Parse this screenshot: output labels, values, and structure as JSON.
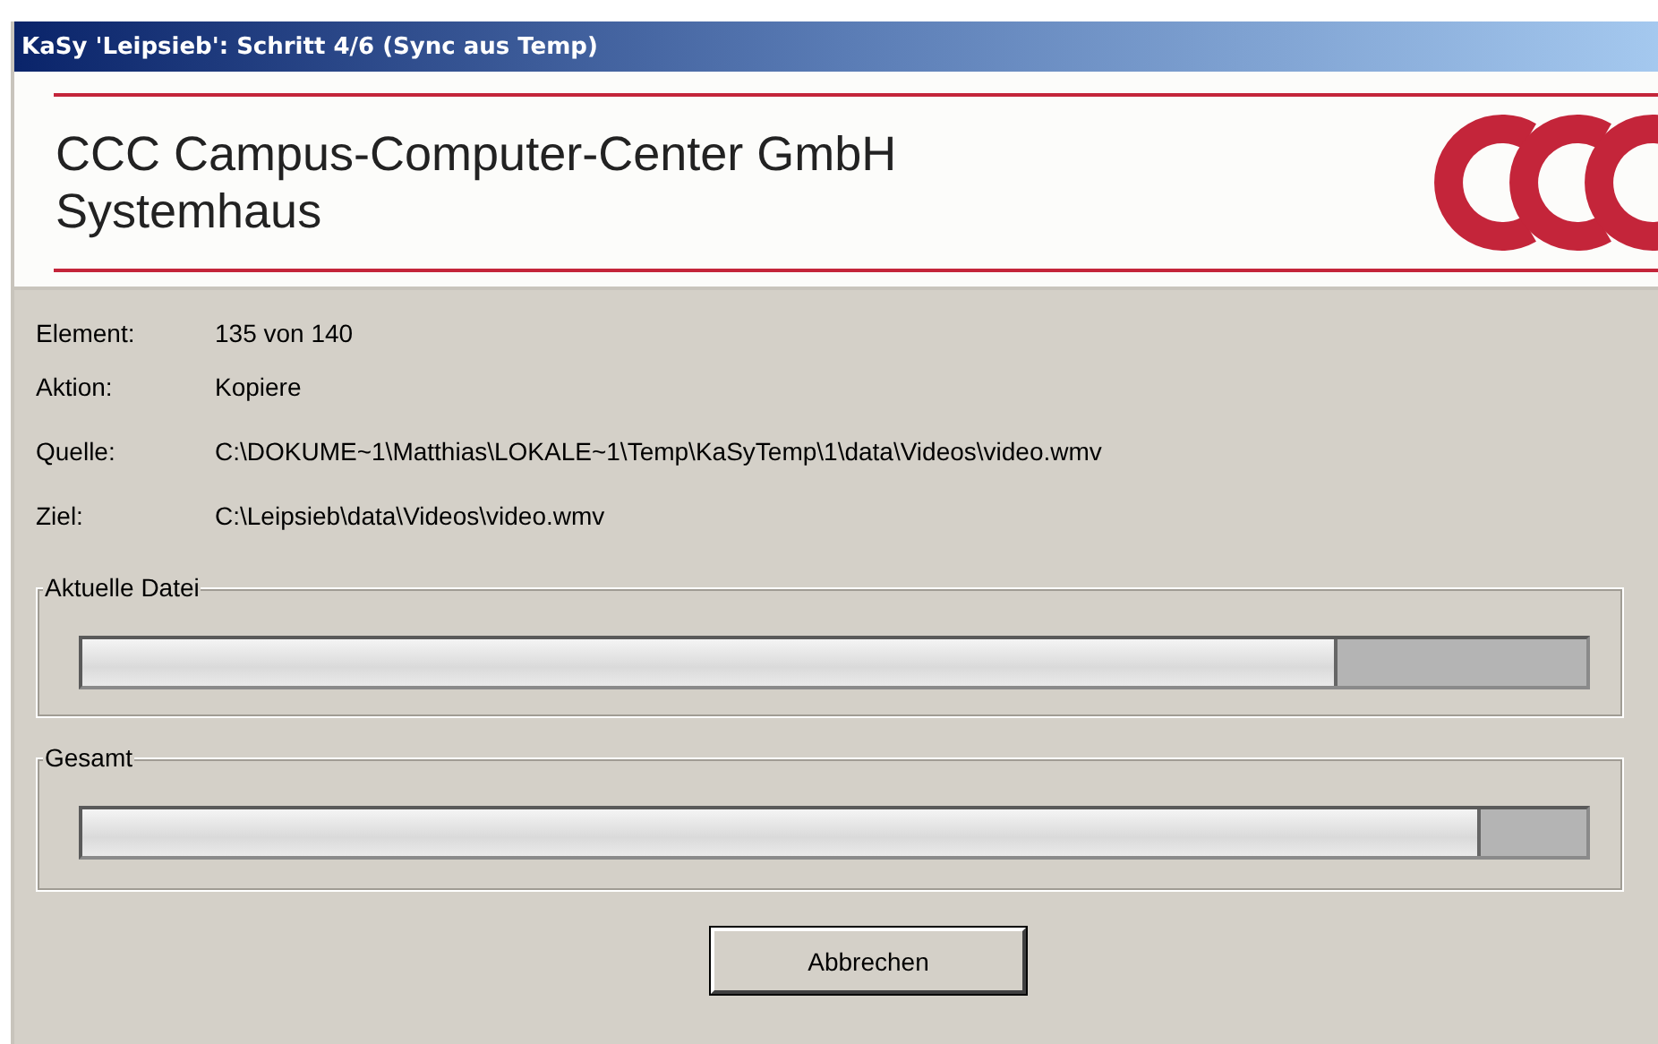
{
  "window": {
    "title": "KaSy 'Leipsieb': Schritt 4/6 (Sync aus Temp)"
  },
  "header": {
    "company": "CCC Campus-Computer-Center GmbH",
    "subtitle": "Systemhaus"
  },
  "details": [
    {
      "label": "Element:",
      "value": "135 von 140"
    },
    {
      "label": "Aktion:",
      "value": "Kopiere"
    },
    {
      "label": "Quelle:",
      "value": "C:\\DOKUME~1\\Matthias\\LOKALE~1\\Temp\\KaSyTemp\\1\\data\\Videos\\video.wmv"
    },
    {
      "label": "Ziel:",
      "value": "C:\\Leipsieb\\data\\Videos\\video.wmv"
    }
  ],
  "progress": [
    {
      "label": "Aktuelle Datei",
      "level": 0.835
    },
    {
      "label": "Gesamt",
      "level": 0.93
    }
  ],
  "buttons": [
    "Abbrechen"
  ]
}
